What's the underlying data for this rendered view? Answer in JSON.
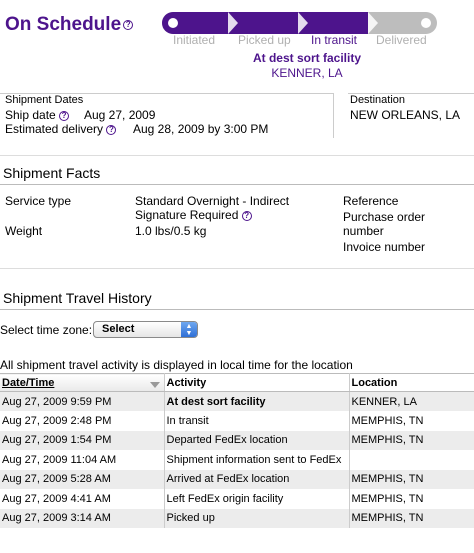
{
  "status": {
    "title": "On Schedule",
    "steps": [
      "Initiated",
      "Picked up",
      "In transit",
      "Delivered"
    ],
    "current_step_index": 2,
    "location_status": "At dest sort facility",
    "location_city": "KENNER, LA"
  },
  "shipment_dates": {
    "heading": "Shipment Dates",
    "ship_date_label": "Ship date",
    "ship_date": "Aug 27, 2009",
    "est_delivery_label": "Estimated delivery",
    "est_delivery": "Aug 28, 2009 by 3:00 PM"
  },
  "destination": {
    "heading": "Destination",
    "value": "NEW ORLEANS, LA"
  },
  "facts": {
    "heading": "Shipment Facts",
    "service_type_label": "Service type",
    "service_type_value": "Standard Overnight - Indirect",
    "signature": "Signature Required",
    "weight_label": "Weight",
    "weight_value": "1.0 lbs/0.5 kg",
    "reference_label": "Reference",
    "po_label_1": "Purchase order",
    "po_label_2": "number",
    "invoice_label": "Invoice number"
  },
  "travel": {
    "heading": "Shipment Travel History",
    "tz_label": "Select time zone:",
    "tz_value": "Select",
    "note": "All shipment travel activity is displayed in local time for the location",
    "columns": [
      "Date/Time",
      "Activity",
      "Location"
    ],
    "rows": [
      {
        "datetime": "Aug 27, 2009 9:59 PM",
        "activity": "At dest sort facility",
        "location": "KENNER, LA"
      },
      {
        "datetime": "Aug 27, 2009 2:48 PM",
        "activity": "In transit",
        "location": "MEMPHIS, TN"
      },
      {
        "datetime": "Aug 27, 2009 1:54 PM",
        "activity": "Departed FedEx location",
        "location": "MEMPHIS, TN"
      },
      {
        "datetime": "Aug 27, 2009 11:04 AM",
        "activity": "Shipment information sent to FedEx",
        "location": ""
      },
      {
        "datetime": "Aug 27, 2009 5:28 AM",
        "activity": "Arrived at FedEx location",
        "location": "MEMPHIS, TN"
      },
      {
        "datetime": "Aug 27, 2009 4:41 AM",
        "activity": "Left FedEx origin facility",
        "location": "MEMPHIS, TN"
      },
      {
        "datetime": "Aug 27, 2009 3:14 AM",
        "activity": "Picked up",
        "location": "MEMPHIS, TN"
      }
    ]
  },
  "colors": {
    "brand_purple": "#4d148c",
    "inactive_gray": "#b0b0b0"
  }
}
